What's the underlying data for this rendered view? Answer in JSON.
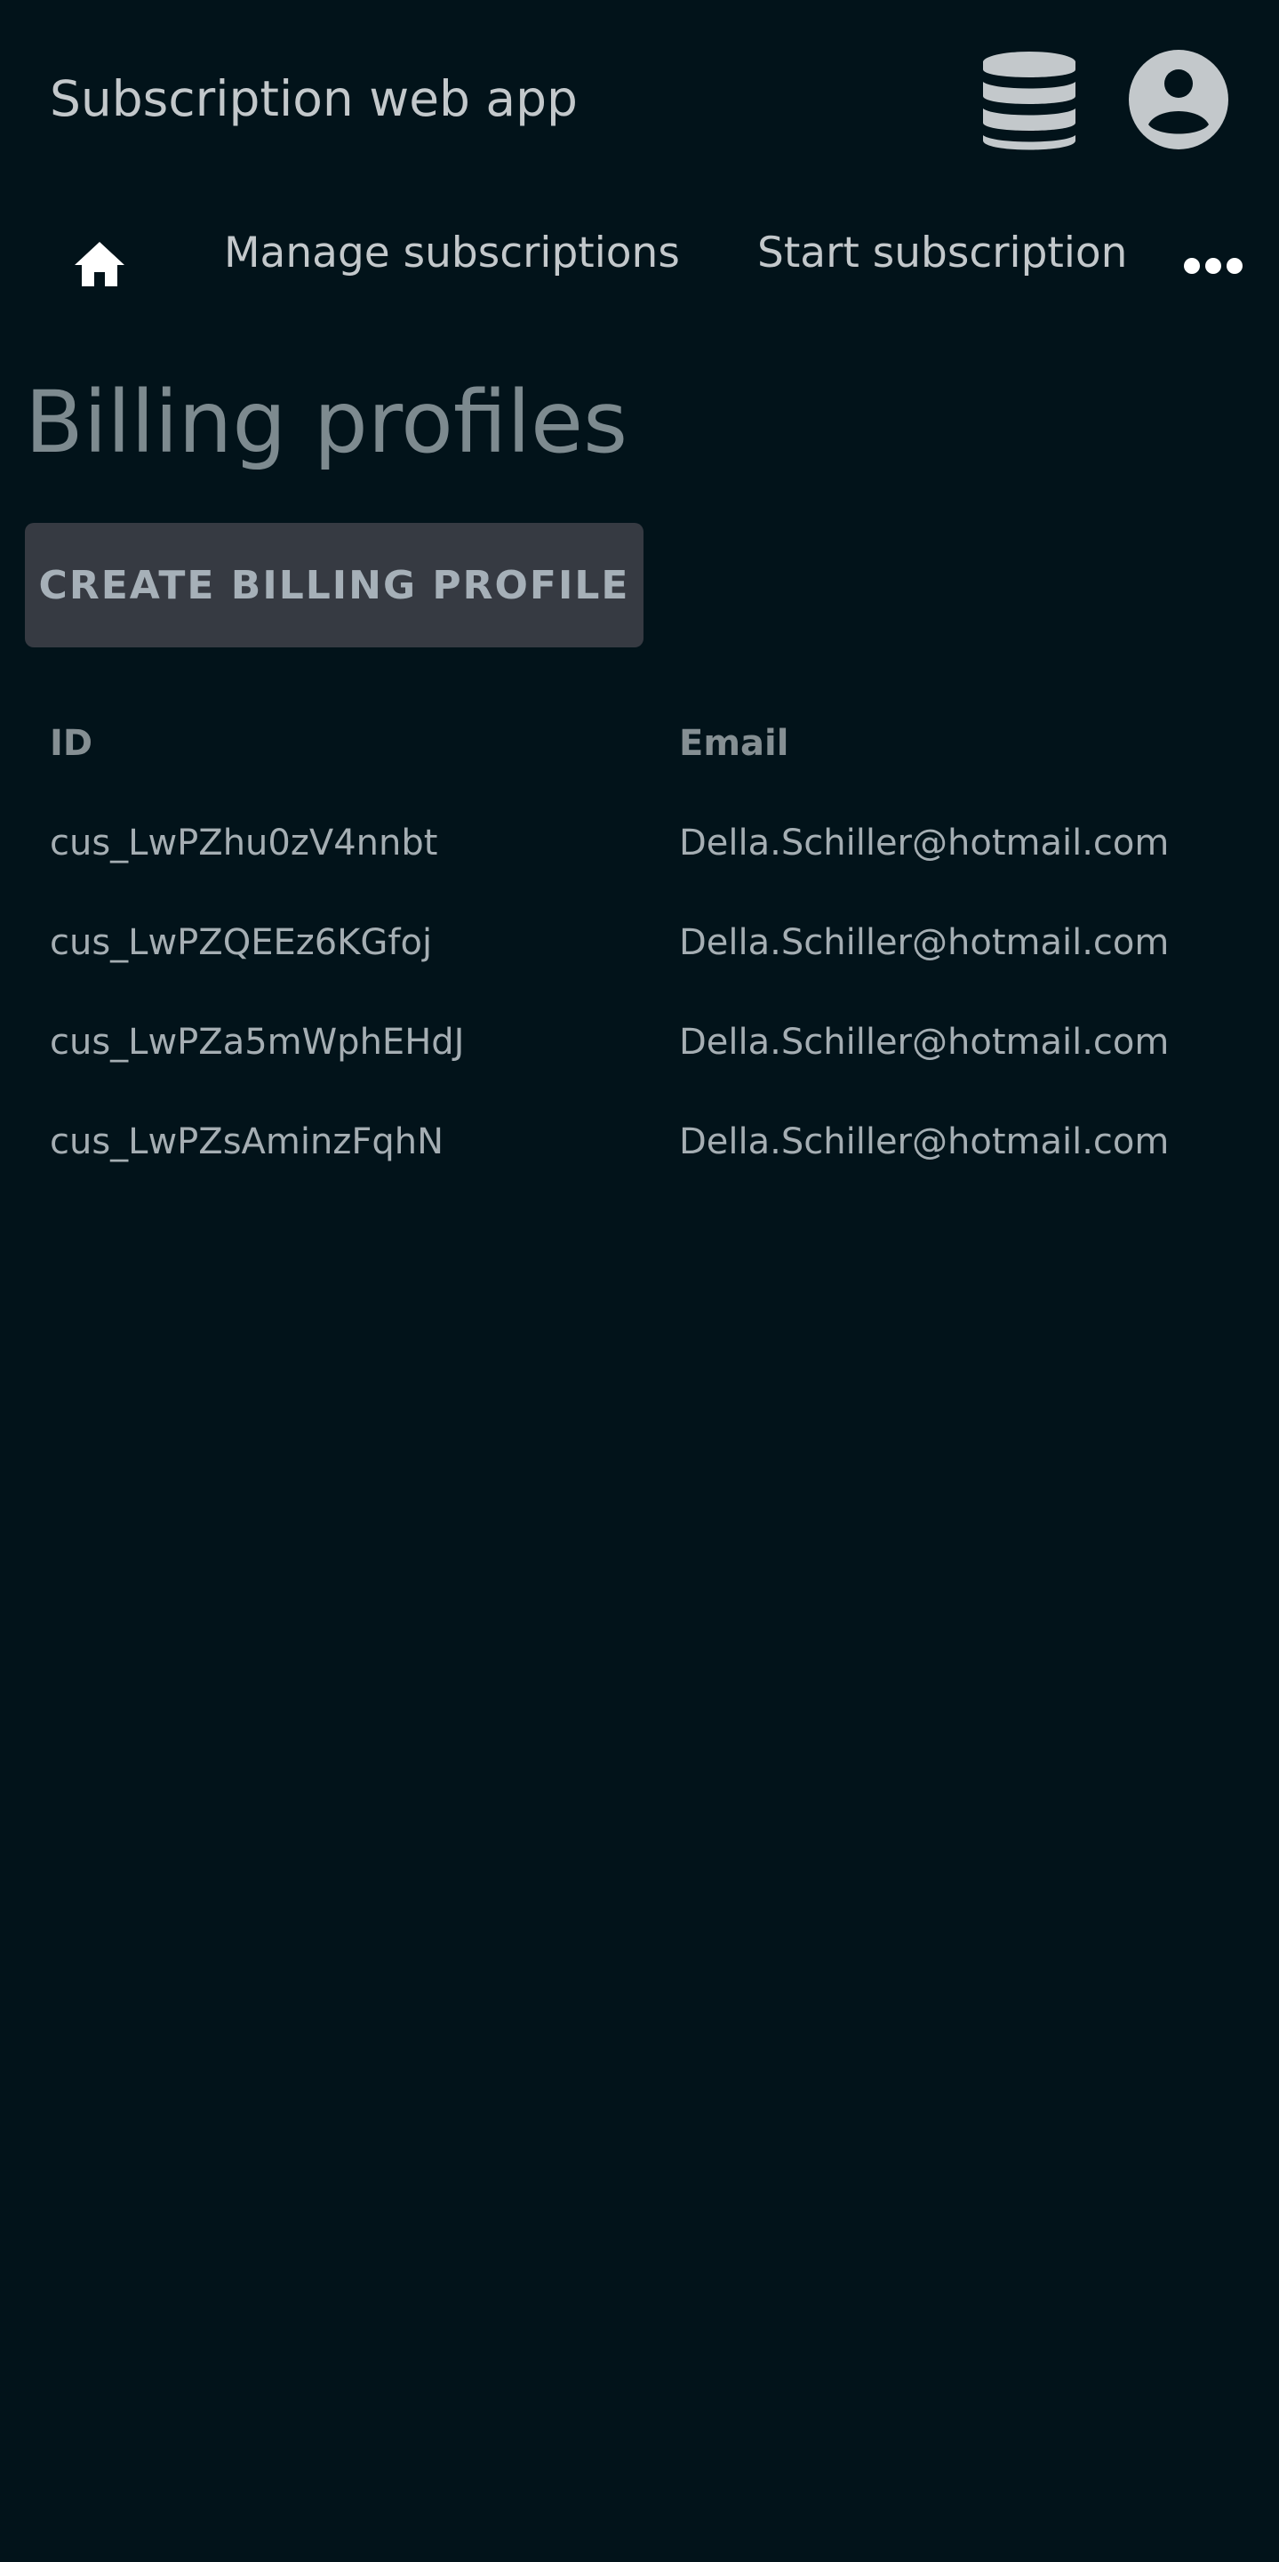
{
  "header": {
    "app_title": "Subscription web app",
    "icons": {
      "database": "database-icon",
      "account": "account-circle-icon"
    }
  },
  "nav": {
    "home_icon": "home-icon",
    "links": [
      {
        "label": "Manage subscriptions"
      },
      {
        "label": "Start subscription"
      }
    ],
    "more_icon": "more-horizontal-icon"
  },
  "page": {
    "title": "Billing profiles",
    "create_button_label": "CREATE BILLING PROFILE"
  },
  "table": {
    "columns": [
      "ID",
      "Email"
    ],
    "rows": [
      {
        "id": "cus_LwPZhu0zV4nnbt",
        "email": "Della.Schiller@hotmail.com"
      },
      {
        "id": "cus_LwPZQEEz6KGfoj",
        "email": "Della.Schiller@hotmail.com"
      },
      {
        "id": "cus_LwPZa5mWphEHdJ",
        "email": "Della.Schiller@hotmail.com"
      },
      {
        "id": "cus_LwPZsAminzFqhN",
        "email": "Della.Schiller@hotmail.com"
      }
    ]
  },
  "colors": {
    "background": "#02131a",
    "button_background": "#363a42",
    "title_text": "#7d8a8f",
    "text": "#c3c8cb"
  }
}
